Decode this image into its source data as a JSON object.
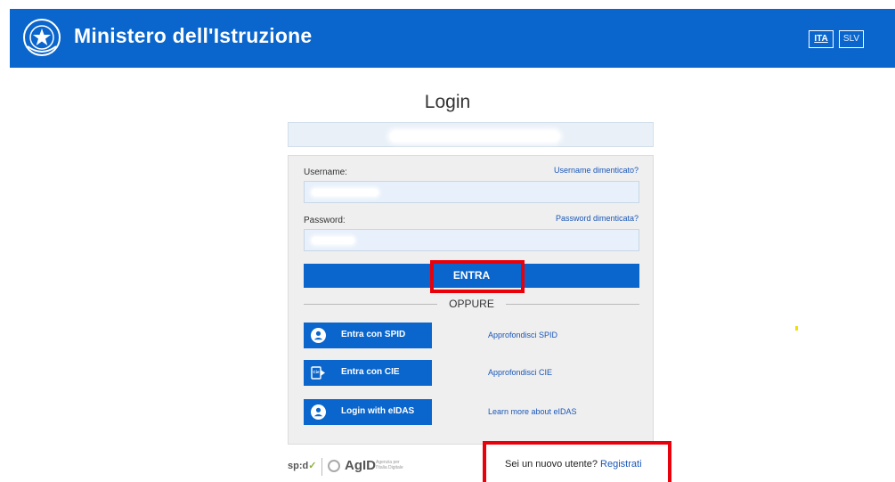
{
  "header": {
    "title": "Ministero dell'Istruzione",
    "emblem_icon": "italian-republic-emblem-icon",
    "languages": [
      {
        "code": "ITA",
        "active": true
      },
      {
        "code": "SLV",
        "active": false
      }
    ]
  },
  "page": {
    "title": "Login"
  },
  "form": {
    "username_label": "Username:",
    "username_forgot": "Username dimenticato?",
    "password_label": "Password:",
    "password_forgot": "Password dimenticata?",
    "submit_label": "ENTRA",
    "divider_label": "OPPURE"
  },
  "alt_logins": [
    {
      "label": "Entra con SPID",
      "icon": "spid-user-icon",
      "link": "Approfondisci SPID"
    },
    {
      "label": "Entra con CIE",
      "icon": "cie-card-icon",
      "link": "Approfondisci CIE"
    },
    {
      "label": "Login with eIDAS",
      "icon": "eidas-user-icon",
      "link": "Learn more about eIDAS"
    }
  ],
  "footer": {
    "spid_logo_text": "sp:d",
    "agid_logo_text": "AgID",
    "agid_small_text": "Agenzia per l'Italia Digitale",
    "new_user_text": "Sei un nuovo utente?",
    "register_link": "Registrati"
  },
  "colors": {
    "brand_blue": "#0a66cc",
    "highlight_red": "#e8000b"
  }
}
